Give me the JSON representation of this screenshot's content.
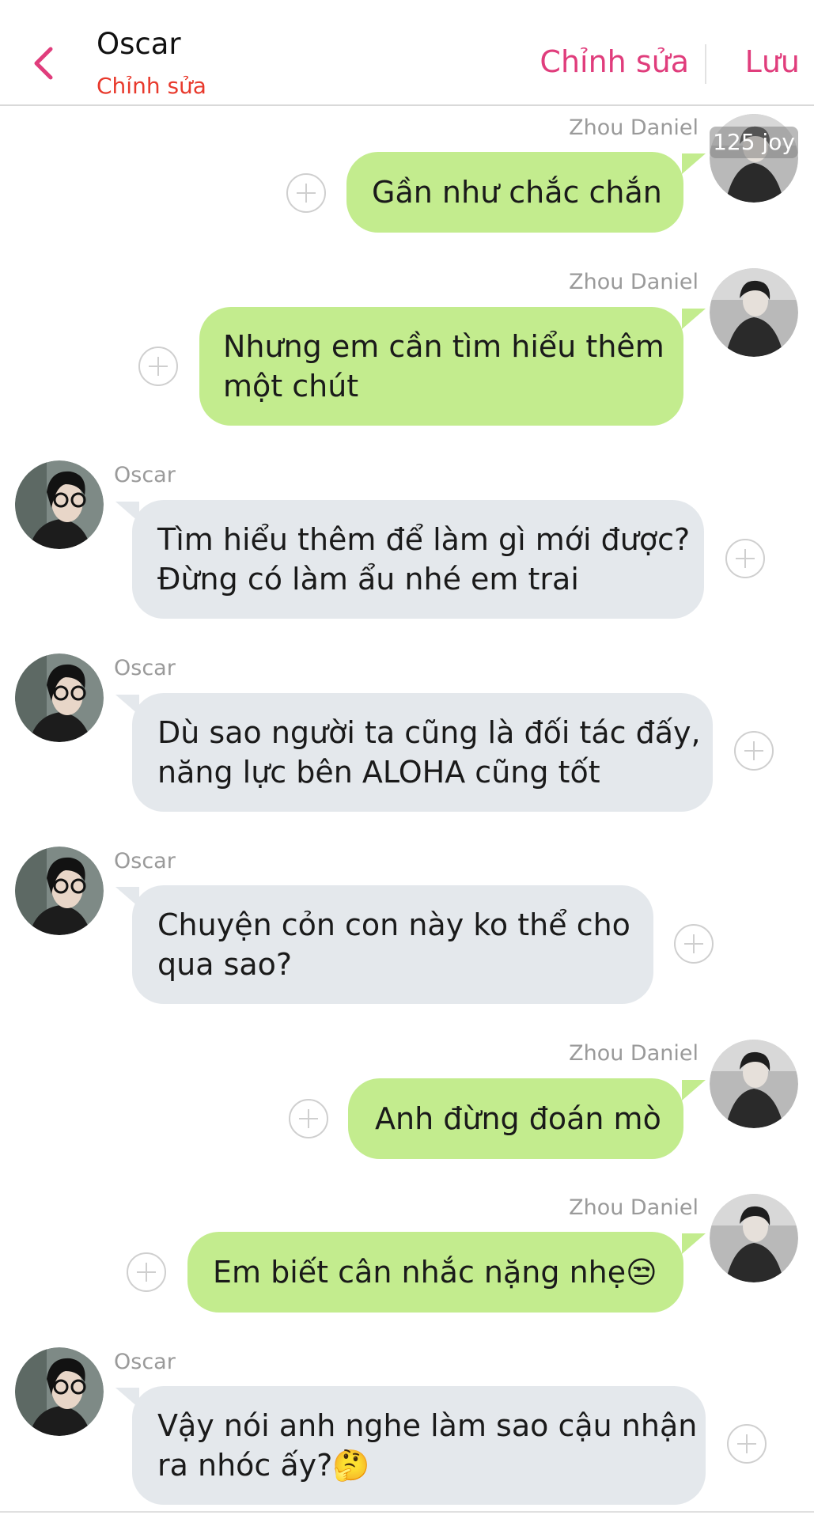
{
  "header": {
    "title": "Oscar",
    "subtitle": "Chỉnh sửa",
    "edit_label": "Chỉnh sửa",
    "save_label": "Lưu"
  },
  "badge": "125 joy",
  "messages": [
    {
      "sender": "Zhou Daniel",
      "text": "Gần như chắc chắn"
    },
    {
      "sender": "Zhou Daniel",
      "text": "Nhưng em cần tìm hiểu thêm\nmột chút"
    },
    {
      "sender": "Oscar",
      "text": "Tìm hiểu thêm để làm gì mới được?\nĐừng có làm ẩu nhé em trai"
    },
    {
      "sender": "Oscar",
      "text": "Dù sao người ta cũng là đối tác đấy,\nnăng lực bên ALOHA cũng tốt"
    },
    {
      "sender": "Oscar",
      "text": "Chuyện cỏn con này ko thể cho\nqua sao?"
    },
    {
      "sender": "Zhou Daniel",
      "text": "Anh đừng đoán mò"
    },
    {
      "sender": "Zhou Daniel",
      "text": "Em biết cân nhắc nặng nhẹ😒"
    },
    {
      "sender": "Oscar",
      "text": "Vậy nói anh nghe làm sao cậu nhận\nra nhóc ấy?🤔"
    }
  ],
  "colors": {
    "accent": "#e03d7c",
    "subtitle": "#e8392c",
    "outgoing_bubble": "#c3ec8e",
    "incoming_bubble": "#e4e8ec"
  },
  "icons": {
    "back": "chevron-left-icon",
    "add": "plus-circle-icon"
  }
}
